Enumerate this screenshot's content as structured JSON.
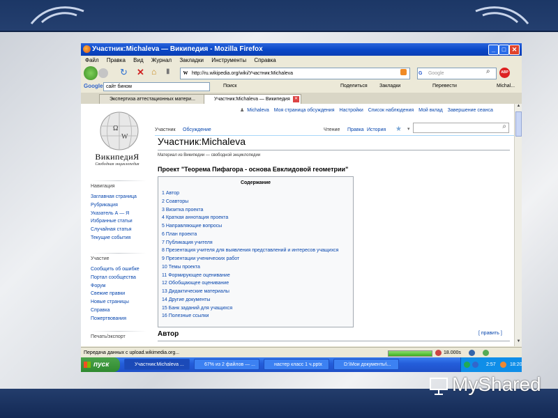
{
  "browser": {
    "title": "Участник:Michaleva — Википедия - Mozilla Firefox",
    "menu": [
      "Файл",
      "Правка",
      "Вид",
      "Журнал",
      "Закладки",
      "Инструменты",
      "Справка"
    ],
    "url": "http://ru.wikipedia.org/wiki/Участник:Michaleva",
    "search_placeholder": "Google",
    "google_toolbar": {
      "brand": "Google",
      "search_value": "сайт бином",
      "search_btn": "Поиск",
      "share": "Поделиться",
      "bookmarks": "Закладки",
      "translate": "Перевести",
      "user": "Michal..."
    },
    "tabs": [
      {
        "label": "Экспертиза аттестационных матери..."
      },
      {
        "label": "Участник:Michaleva — Википедия"
      }
    ],
    "status_text": "Передача данных с upload.wikimedia.org...",
    "load_time": "18.000s"
  },
  "wiki": {
    "site_name": "ВикипедиЯ",
    "slogan": "Свободная энциклопедия",
    "personal": [
      "Michaleva",
      "Моя страница обсуждения",
      "Настройки",
      "Список наблюдения",
      "Мой вклад",
      "Завершение сеанса"
    ],
    "tabs_left": [
      "Участник",
      "Обсуждение"
    ],
    "tabs_right": [
      "Чтение",
      "Правка",
      "История"
    ],
    "nav_heading": "Навигация",
    "nav_links": [
      "Заглавная страница",
      "Рубрикация",
      "Указатель А — Я",
      "Избранные статьи",
      "Случайная статья",
      "Текущие события"
    ],
    "part_heading": "Участие",
    "part_links": [
      "Сообщить об ошибке",
      "Портал сообщества",
      "Форум",
      "Свежие правки",
      "Новые страницы",
      "Справка",
      "Пожертвования"
    ],
    "print_heading": "Печать/экспорт",
    "page_title": "Участник:Michaleva",
    "from_wiki": "Материал из Википедии — свободной энциклопедии",
    "project_heading": "Проект \"Теорема Пифагора - основа Евклидовой геометрии\"",
    "toc_title": "Содержание",
    "toc_items": [
      "1 Автор",
      "2 Соавторы",
      "3 Визитка проекта",
      "4 Краткая аннотация проекта",
      "5 Направляющие вопросы",
      "6 План проекта",
      "7 Публикация учителя",
      "8 Презентация учителя для выявления представлений и интересов учащихся",
      "9 Презентации ученических работ",
      "10 Темы проекта",
      "11 Формирующее оценивание",
      "12 Обобщающее оценивание",
      "13 Дидактические материалы",
      "14 Другие документы",
      "15 Банк заданий для учащихся",
      "16 Полезные ссылки"
    ],
    "section_heading": "Автор",
    "edit_link": "[ править ]"
  },
  "taskbar": {
    "start": "пуск",
    "tasks": [
      "Участник:Michaleva ...",
      "67% из 2 файлов — ...",
      "настер класс 1 ч.pptx",
      "D:\\Мои документы\\..."
    ],
    "time_left": "2:57",
    "clock": "18:20"
  },
  "watermark": "MyShared"
}
